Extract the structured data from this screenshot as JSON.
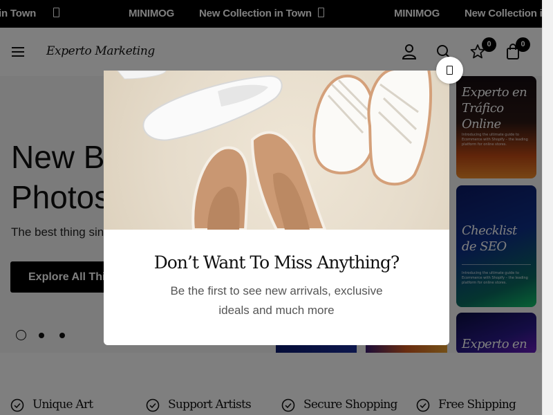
{
  "announcement": {
    "items": [
      "in Town",
      "MINIMOG",
      "New Collection in Town",
      "MINIMOG",
      "New Collection in"
    ]
  },
  "header": {
    "logo": "Experto Marketing",
    "wishlist_count": "0",
    "cart_count": "0"
  },
  "hero": {
    "title_line1": "New B",
    "title_line2": "Photos",
    "subtitle": "The best thing sin",
    "button_label": "Explore All Thin",
    "slides": 3,
    "active_slide": 1
  },
  "product_cards": [
    {
      "title": "Experto en Tráfico Online",
      "description": "Introducing the ultimate guide to Ecommerce with Shopify – the leading platform for online stores."
    },
    {
      "title": "Checklist de SEO",
      "description": "Introducing the ultimate guide to Ecommerce with Shopify – the leading platform for online stores."
    },
    {
      "title": "Experto en",
      "description": ""
    }
  ],
  "features": [
    "Unique Art",
    "Support Artists",
    "Secure Shopping",
    "Free Shipping"
  ],
  "popup": {
    "title": "Don’t Want To Miss Anything?",
    "text": "Be the first to see new arrivals, exclusive ideals and much more"
  },
  "colors": {
    "overlay": "rgba(0,0,0,0.5)",
    "primary": "#000000",
    "accent_green": "#2ee07a"
  }
}
